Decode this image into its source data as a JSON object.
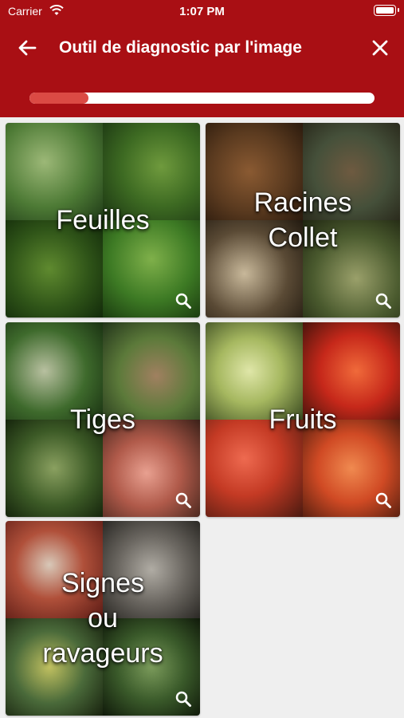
{
  "status_bar": {
    "carrier": "Carrier",
    "time": "1:07 PM"
  },
  "nav": {
    "title": "Outil de diagnostic par l'image",
    "back_icon": "arrow-left-icon",
    "close_icon": "close-icon"
  },
  "progress": {
    "value": 0.17
  },
  "colors": {
    "header": "#a90f14",
    "progress_fill": "#db4a44",
    "background": "#efefef"
  },
  "categories": [
    {
      "label_lines": [
        "Feuilles"
      ],
      "icon": "magnifier-icon"
    },
    {
      "label_lines": [
        "Racines",
        "Collet"
      ],
      "icon": "magnifier-icon"
    },
    {
      "label_lines": [
        "Tiges"
      ],
      "icon": "magnifier-icon"
    },
    {
      "label_lines": [
        "Fruits"
      ],
      "icon": "magnifier-icon"
    },
    {
      "label_lines": [
        "Signes",
        "ou",
        "ravageurs"
      ],
      "icon": "magnifier-icon"
    }
  ]
}
